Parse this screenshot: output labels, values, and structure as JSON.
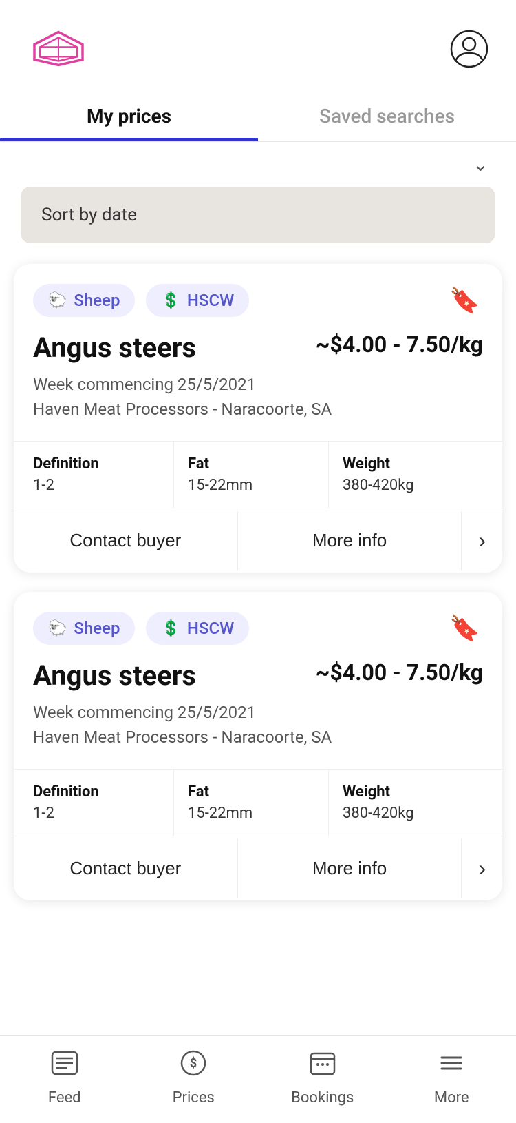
{
  "header": {
    "profile_label": "Profile"
  },
  "tabs": [
    {
      "id": "my-prices",
      "label": "My prices",
      "active": true
    },
    {
      "id": "saved-searches",
      "label": "Saved searches",
      "active": false
    }
  ],
  "sort_bar": {
    "label": "Sort by date"
  },
  "listings": [
    {
      "id": "listing-1",
      "tags": [
        {
          "id": "sheep",
          "label": "Sheep",
          "icon": "🐑"
        },
        {
          "id": "hscw",
          "label": "HSCW",
          "icon": "💲"
        }
      ],
      "title": "Angus steers",
      "price": "~$4.00 - 7.50/kg",
      "week": "Week commencing 25/5/2021",
      "location": "Haven Meat Processors - Naracoorte, SA",
      "specs": [
        {
          "label": "Definition",
          "value": "1-2"
        },
        {
          "label": "Fat",
          "value": "15-22mm"
        },
        {
          "label": "Weight",
          "value": "380-420kg"
        }
      ],
      "contact_buyer_label": "Contact buyer",
      "more_info_label": "More info"
    },
    {
      "id": "listing-2",
      "tags": [
        {
          "id": "sheep",
          "label": "Sheep",
          "icon": "🐑"
        },
        {
          "id": "hscw",
          "label": "HSCW",
          "icon": "💲"
        }
      ],
      "title": "Angus steers",
      "price": "~$4.00 - 7.50/kg",
      "week": "Week commencing 25/5/2021",
      "location": "Haven Meat Processors - Naracoorte, SA",
      "specs": [
        {
          "label": "Definition",
          "value": "1-2"
        },
        {
          "label": "Fat",
          "value": "15-22mm"
        },
        {
          "label": "Weight",
          "value": "380-420kg"
        }
      ],
      "contact_buyer_label": "Contact buyer",
      "more_info_label": "More info"
    }
  ],
  "bottom_nav": [
    {
      "id": "feed",
      "label": "Feed",
      "icon": "feed"
    },
    {
      "id": "prices",
      "label": "Prices",
      "icon": "prices"
    },
    {
      "id": "bookings",
      "label": "Bookings",
      "icon": "bookings"
    },
    {
      "id": "more",
      "label": "More",
      "icon": "more"
    }
  ]
}
